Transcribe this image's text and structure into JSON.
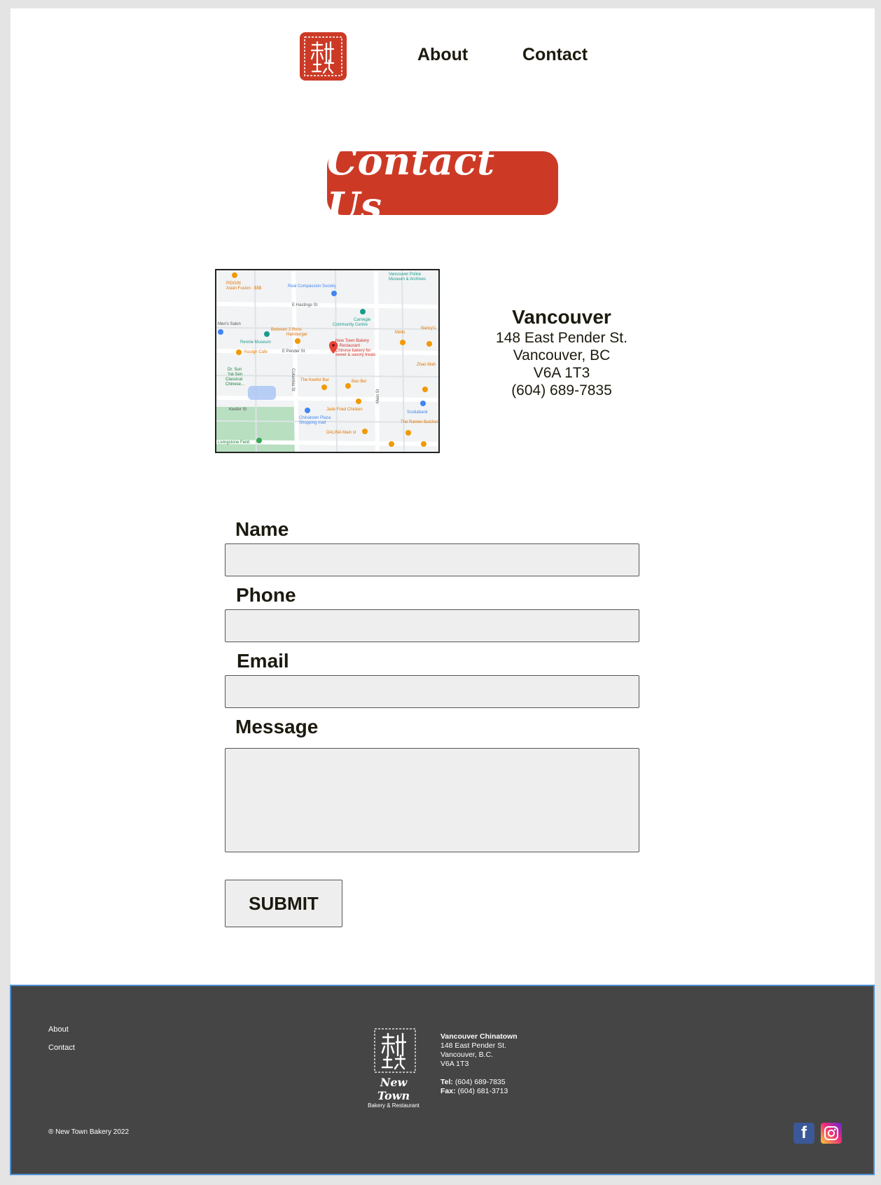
{
  "nav": {
    "about": "About",
    "contact": "Contact"
  },
  "heading": "Contact Us",
  "map": {
    "labels": [
      "PIDGIN",
      "Asian Fusion · $$$",
      "Real Compassion Society",
      "Vancouver Police",
      "Museum & Archives",
      "E Hastings St",
      "Carnegie",
      "Community Centre",
      "Men's Salon",
      "Between 2 Buns",
      "Hamburger",
      "Rennie Museum",
      "Mello",
      "Nancy's",
      "New Town Bakery",
      "& Restaurant",
      "Chinese bakery for",
      "sweet & savory treats",
      "Kouign Cafe",
      "E Pender St",
      "Dr. Sun",
      "Yat-Sen",
      "Classical",
      "Chinese...",
      "The Keefer Bar",
      "Bao Bei",
      "Zhao Mah",
      "Keefer St",
      "Jade Fried Chicken",
      "Scotiabank",
      "Chinatown Plaza",
      "Shopping mall",
      "The Ramen Butcher",
      "DALINA Main st",
      "Livingstone Field",
      "Main St",
      "Columbia St"
    ]
  },
  "location": {
    "city": "Vancouver",
    "street": "148 East Pender St.",
    "region": "Vancouver, BC",
    "postal": "V6A 1T3",
    "phone": "(604) 689-7835"
  },
  "form": {
    "name_label": "Name",
    "phone_label": "Phone",
    "email_label": "Email",
    "message_label": "Message",
    "submit_label": "SUBMIT"
  },
  "footer": {
    "links": {
      "about": "About",
      "contact": "Contact"
    },
    "brand_name": "New Town",
    "brand_sub": "Bakery & Restaurant",
    "address_title": "Vancouver Chinatown",
    "address_street": "148 East Pender St.",
    "address_city": "Vancouver, B.C.",
    "address_postal": "V6A 1T3",
    "tel_label": "Tel:",
    "tel": "(604) 689-7835",
    "fax_label": "Fax:",
    "fax": "(604) 681-3713",
    "copyright": "® New Town Bakery 2022",
    "social": {
      "facebook": "facebook-icon",
      "instagram": "instagram-icon"
    }
  },
  "colors": {
    "brand_red": "#cc3a26",
    "footer_bg": "#454545",
    "text_dark": "#1c1a0e"
  }
}
